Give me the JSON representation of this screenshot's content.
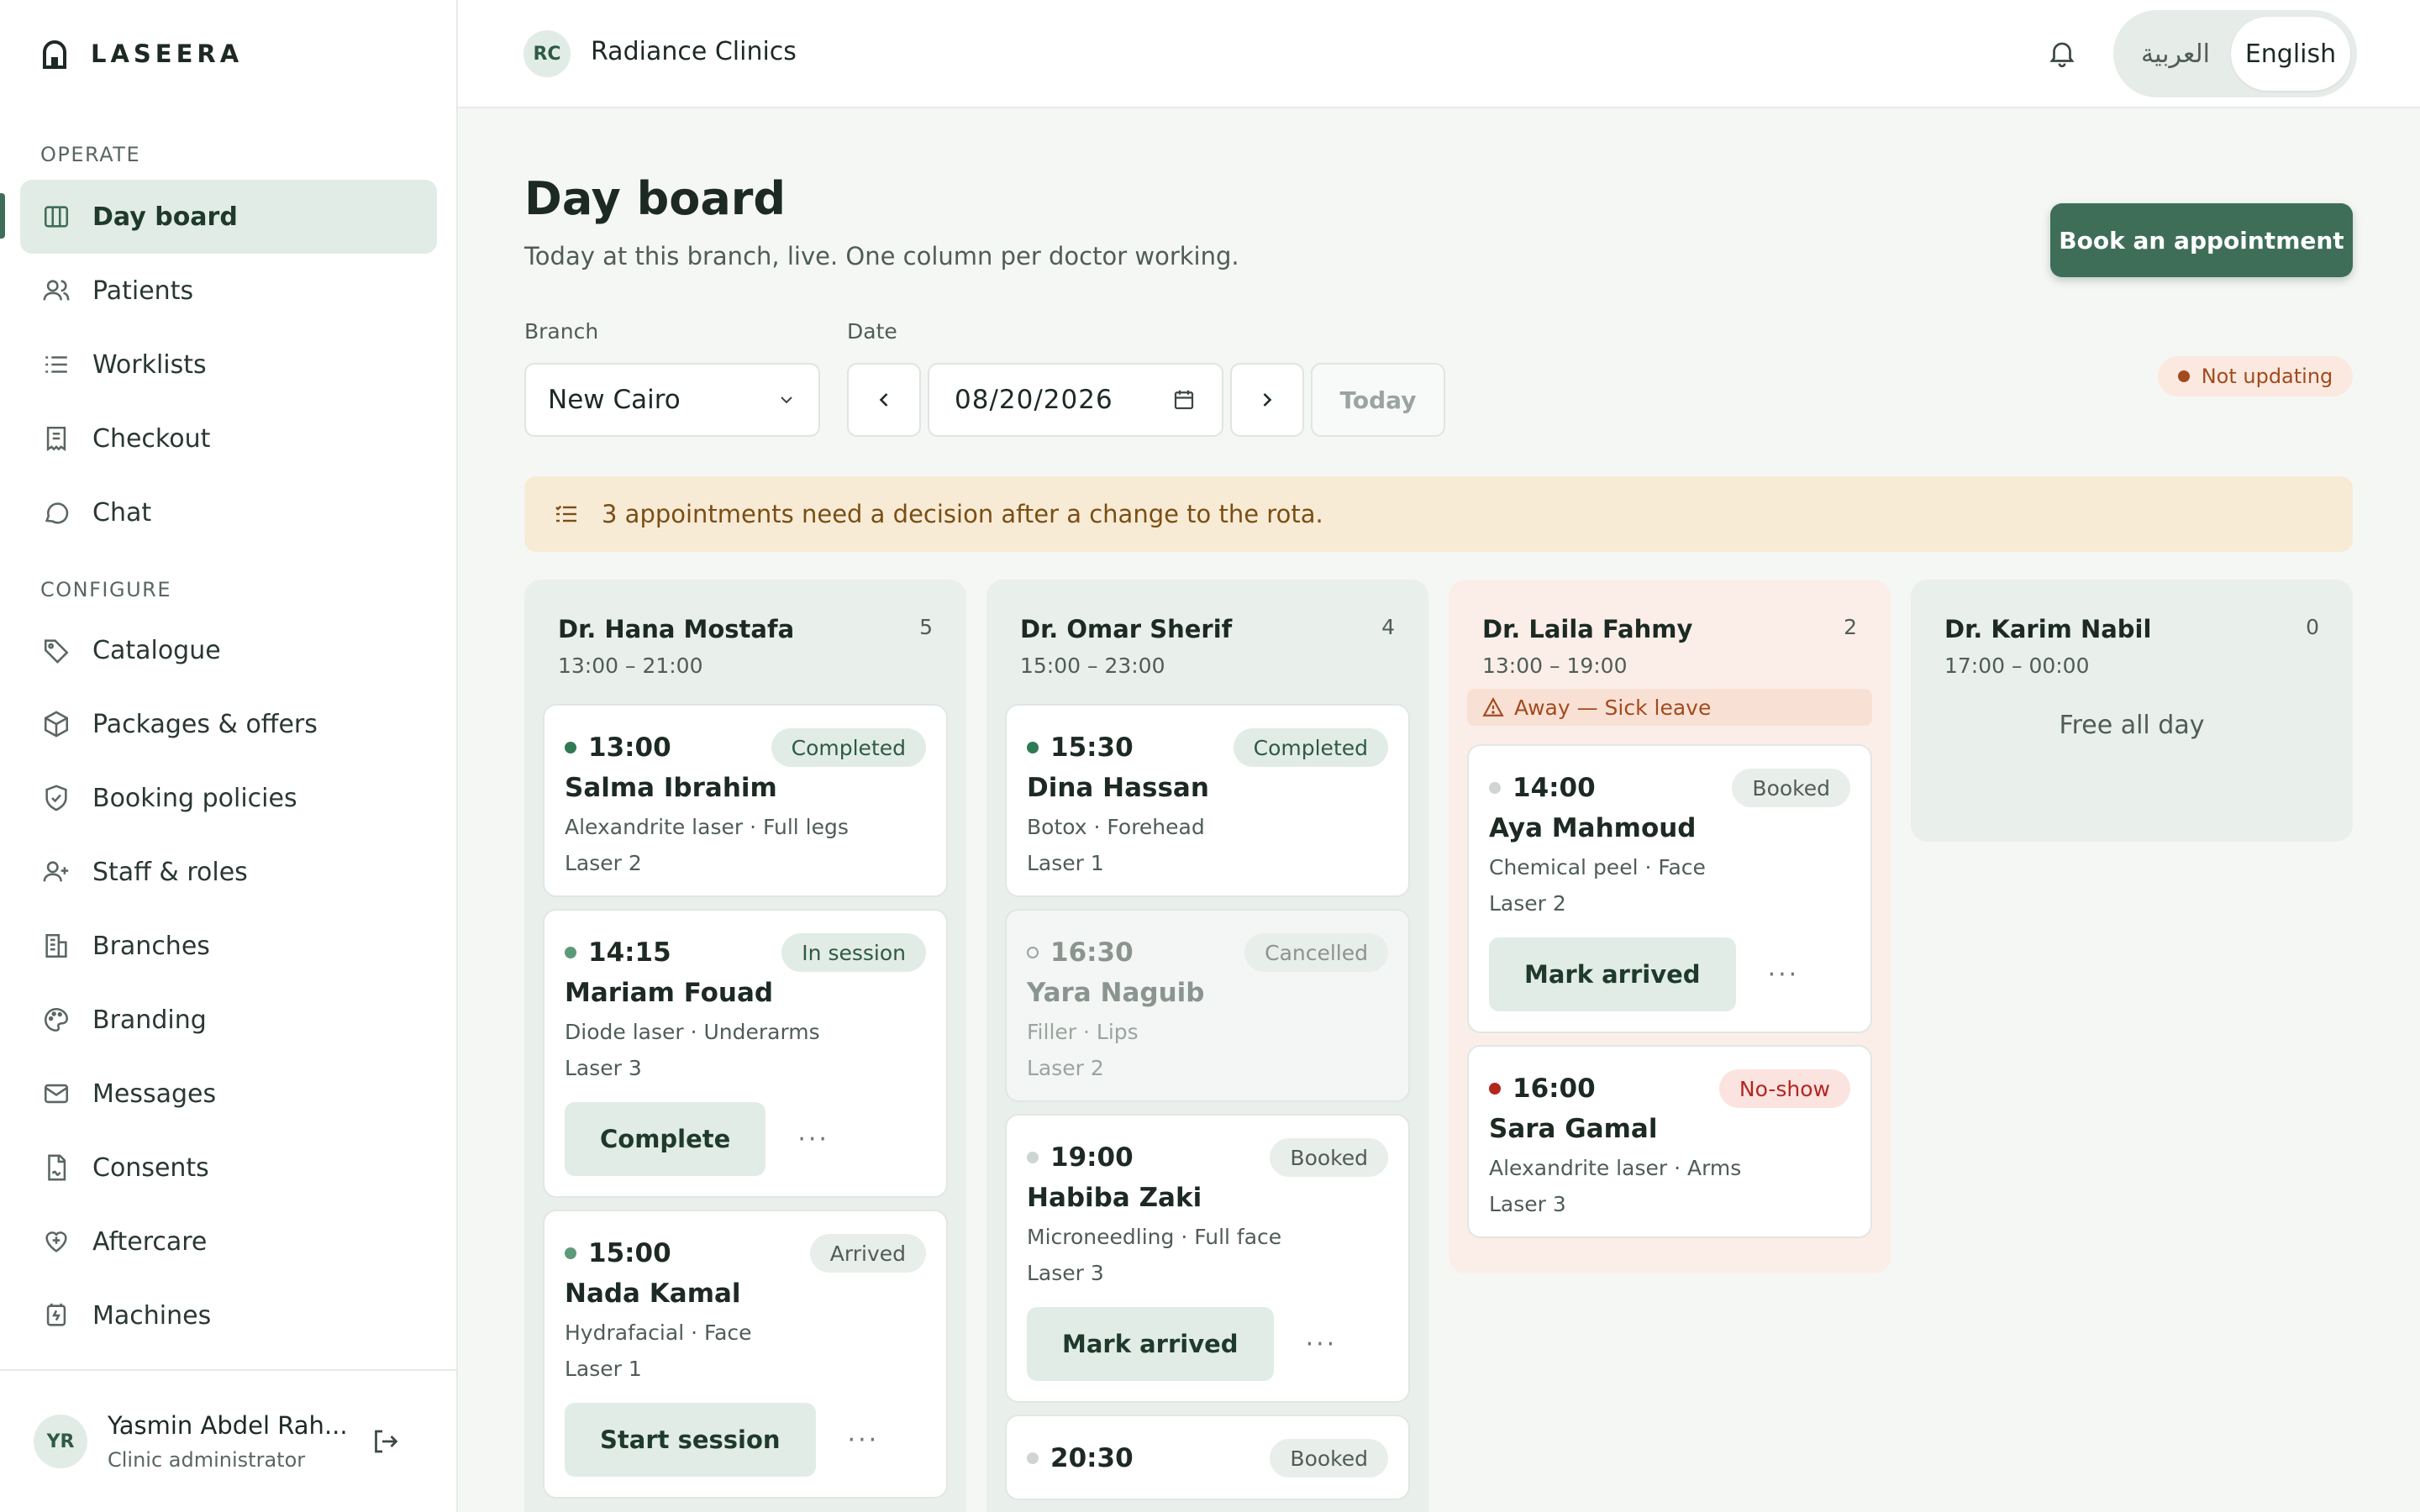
{
  "app": {
    "logo": "LASEERA"
  },
  "sidebar": {
    "operate_label": "OPERATE",
    "configure_label": "CONFIGURE",
    "operate_items": [
      {
        "label": "Day board",
        "icon": "columns-icon",
        "active": true
      },
      {
        "label": "Patients",
        "icon": "users-icon"
      },
      {
        "label": "Worklists",
        "icon": "list-icon"
      },
      {
        "label": "Checkout",
        "icon": "receipt-icon"
      },
      {
        "label": "Chat",
        "icon": "chat-icon"
      }
    ],
    "configure_items": [
      {
        "label": "Catalogue",
        "icon": "tag-icon"
      },
      {
        "label": "Packages & offers",
        "icon": "package-icon"
      },
      {
        "label": "Booking policies",
        "icon": "shield-icon"
      },
      {
        "label": "Staff & roles",
        "icon": "user-plus-icon"
      },
      {
        "label": "Branches",
        "icon": "building-icon"
      },
      {
        "label": "Branding",
        "icon": "palette-icon"
      },
      {
        "label": "Messages",
        "icon": "mail-icon"
      },
      {
        "label": "Consents",
        "icon": "document-sign-icon"
      },
      {
        "label": "Aftercare",
        "icon": "heart-care-icon"
      },
      {
        "label": "Machines",
        "icon": "machine-icon"
      }
    ],
    "user": {
      "initials": "YR",
      "name": "Yasmin Abdel Rah...",
      "role": "Clinic administrator"
    }
  },
  "topbar": {
    "org_initials": "RC",
    "org_name": "Radiance Clinics",
    "lang_ar": "العربية",
    "lang_en": "English"
  },
  "page": {
    "title": "Day board",
    "subtitle": "Today at this branch, live. One column per doctor working.",
    "book_button": "Book an appointment",
    "branch_label": "Branch",
    "branch_value": "New Cairo",
    "date_label": "Date",
    "date_value": "08/20/2026",
    "today_button": "Today",
    "live_status": "Not updating",
    "banner": "3 appointments need a decision after a change to the rota."
  },
  "colors": {
    "accent": "#3f6e58",
    "completed": "#2f7a55",
    "in_session": "#2f7a55",
    "booked": "#cfd6d2",
    "no_show": "#b3261e",
    "away_bg": "#fbeee8"
  },
  "doctors": [
    {
      "name": "Dr. Hana Mostafa",
      "count": "5",
      "hours": "13:00 – 21:00",
      "appointments": [
        {
          "time": "13:00",
          "status": "Completed",
          "patient": "Salma Ibrahim",
          "procedure": "Alexandrite laser · Full legs",
          "room": "Laser 2"
        },
        {
          "time": "14:15",
          "status": "In session",
          "patient": "Mariam Fouad",
          "procedure": "Diode laser · Underarms",
          "room": "Laser 3",
          "action": "Complete"
        },
        {
          "time": "15:00",
          "status": "Arrived",
          "patient": "Nada Kamal",
          "procedure": "Hydrafacial · Face",
          "room": "Laser 1",
          "action": "Start session"
        }
      ]
    },
    {
      "name": "Dr. Omar Sherif",
      "count": "4",
      "hours": "15:00 – 23:00",
      "appointments": [
        {
          "time": "15:30",
          "status": "Completed",
          "patient": "Dina Hassan",
          "procedure": "Botox · Forehead",
          "room": "Laser 1"
        },
        {
          "time": "16:30",
          "status": "Cancelled",
          "patient": "Yara Naguib",
          "procedure": "Filler · Lips",
          "room": "Laser 2"
        },
        {
          "time": "19:00",
          "status": "Booked",
          "patient": "Habiba Zaki",
          "procedure": "Microneedling · Full face",
          "room": "Laser 3",
          "action": "Mark arrived"
        },
        {
          "time": "20:30",
          "status": "Booked"
        }
      ]
    },
    {
      "name": "Dr. Laila Fahmy",
      "count": "2",
      "hours": "13:00 – 19:00",
      "away": "Away — Sick leave",
      "appointments": [
        {
          "time": "14:00",
          "status": "Booked",
          "patient": "Aya Mahmoud",
          "procedure": "Chemical peel · Face",
          "room": "Laser 2",
          "action": "Mark arrived"
        },
        {
          "time": "16:00",
          "status": "No-show",
          "patient": "Sara Gamal",
          "procedure": "Alexandrite laser · Arms",
          "room": "Laser 3"
        }
      ]
    },
    {
      "name": "Dr. Karim Nabil",
      "count": "0",
      "hours": "17:00 – 00:00",
      "free": "Free all day"
    }
  ]
}
